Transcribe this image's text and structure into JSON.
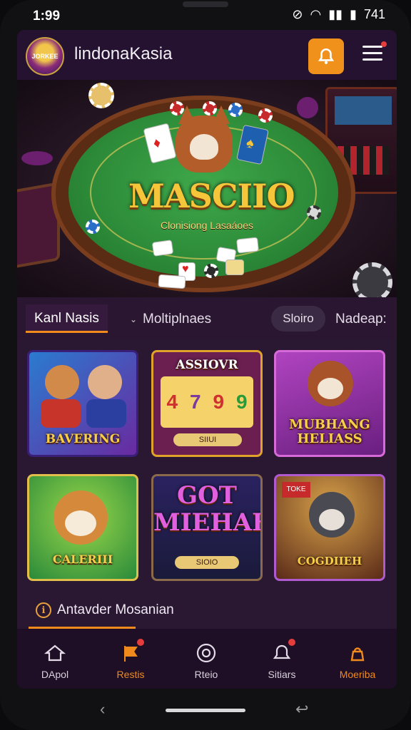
{
  "status_bar": {
    "time": "1:99",
    "right": "741"
  },
  "app": {
    "title": "lindonaKasia",
    "logo_text": "JORKEE"
  },
  "hero": {
    "title": "MASCIIO",
    "subtitle": "Clonisiong Lasaáoes"
  },
  "tabs": [
    {
      "label": "Kanl Nasis",
      "active": true
    },
    {
      "label": "Moltiplnaes",
      "active": false
    },
    {
      "label": "Sloiro",
      "active": false
    },
    {
      "label": "Nadeap:",
      "active": false
    }
  ],
  "games": [
    {
      "label": "BAVERING"
    },
    {
      "label": "ASSIOVR",
      "reels": [
        "4",
        "7",
        "9",
        "9"
      ],
      "sub": "SIIUI"
    },
    {
      "label": "MUBHANG HELIASS"
    },
    {
      "label": "CALERIII"
    },
    {
      "label": "GOT MIEHAKK",
      "sub": "SIOIO"
    },
    {
      "label": "COGDIIEH",
      "badge": "TOKE"
    }
  ],
  "section": {
    "label": "Antavder Mosanian"
  },
  "nav": [
    {
      "label": "DApol",
      "icon": "home-icon",
      "active": false
    },
    {
      "label": "Restis",
      "icon": "flag-icon",
      "active": true
    },
    {
      "label": "Rteio",
      "icon": "target-icon",
      "active": false
    },
    {
      "label": "Sitiars",
      "icon": "bell-icon",
      "active": false
    },
    {
      "label": "Moeriba",
      "icon": "bag-icon",
      "active": true
    }
  ],
  "colors": {
    "accent": "#f08a1c",
    "background": "#221228",
    "gold": "#f5c53a"
  }
}
